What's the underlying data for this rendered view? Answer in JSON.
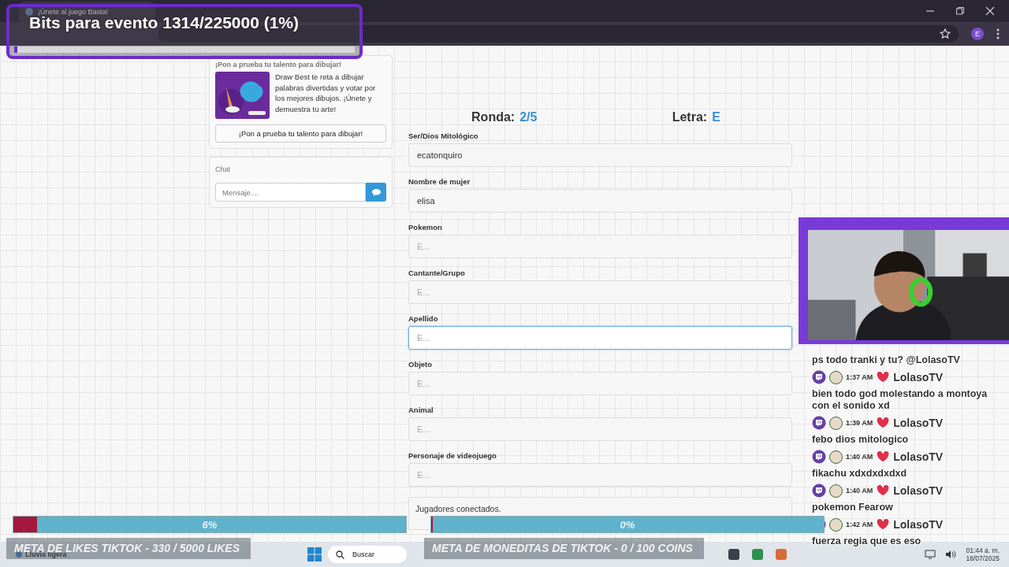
{
  "browser": {
    "tab_title": "¡Únete al juego Basta!",
    "profile_initial": "E"
  },
  "bits_goal": {
    "text": "Bits para evento 1314/225000 (1%)",
    "level": 0.01
  },
  "promo": {
    "heading": "¡Pon a prueba tu talento para dibujar!",
    "description": "Draw Best te reta a dibujar palabras divertidas y votar por los mejores dibujos. ¡Únete y demuestra tu arte!",
    "button": "¡Pon a prueba tu talento para dibujar!"
  },
  "chat_panel": {
    "title": "Chat",
    "placeholder": "Mensaje...."
  },
  "round": {
    "label": "Ronda:",
    "value": "2/5"
  },
  "letter": {
    "label": "Letra:",
    "value": "E"
  },
  "fields": [
    {
      "label": "Ser/Dios Mitológico",
      "value": "ecatonquiro",
      "focused": false
    },
    {
      "label": "Nombre de mujer",
      "value": "elisa",
      "focused": false
    },
    {
      "label": "Pokemon",
      "placeholder": "E...",
      "focused": false
    },
    {
      "label": "Cantante/Grupo",
      "placeholder": "E...",
      "focused": false
    },
    {
      "label": "Apellido",
      "placeholder": "E...",
      "focused": true
    },
    {
      "label": "Objeto",
      "placeholder": "E...",
      "focused": false
    },
    {
      "label": "Animal",
      "placeholder": "E...",
      "focused": false
    },
    {
      "label": "Personaje de videojuego",
      "placeholder": "E...",
      "focused": false
    }
  ],
  "players_box": {
    "text": "Jugadores conectados."
  },
  "goals": [
    {
      "percent": "6%",
      "level": 0.06,
      "text": "META DE LIKES TIKTOK - 330 / 5000 LIKES"
    },
    {
      "percent": "0%",
      "level": 0,
      "text": "META DE MONEDITAS DE TIKTOK - 0 / 100 COINS"
    }
  ],
  "stream_chat": [
    {
      "kind": "message",
      "text": "ps todo tranki y tu? @LolasoTV"
    },
    {
      "kind": "meta",
      "time": "1:37 AM",
      "name": "LolasoTV"
    },
    {
      "kind": "message",
      "text": "bien todo god molestando a montoya con el sonido xd"
    },
    {
      "kind": "meta",
      "time": "1:39 AM",
      "name": "LolasoTV"
    },
    {
      "kind": "message",
      "text": "febo dios mitologico"
    },
    {
      "kind": "meta",
      "time": "1:40 AM",
      "name": "LolasoTV"
    },
    {
      "kind": "message",
      "text": "fikachu xdxdxdxdxd"
    },
    {
      "kind": "meta",
      "time": "1:40 AM",
      "name": "LolasoTV"
    },
    {
      "kind": "message",
      "text": "pokemon Fearow"
    },
    {
      "kind": "meta",
      "time": "1:42 AM",
      "name": "LolasoTV"
    },
    {
      "kind": "message",
      "text": "fuerza regia que es eso"
    }
  ],
  "taskbar": {
    "weather": "Lluvia ligera",
    "search_placeholder": "Buscar",
    "time": "01:44 a. m.",
    "date": "18/07/2025"
  }
}
